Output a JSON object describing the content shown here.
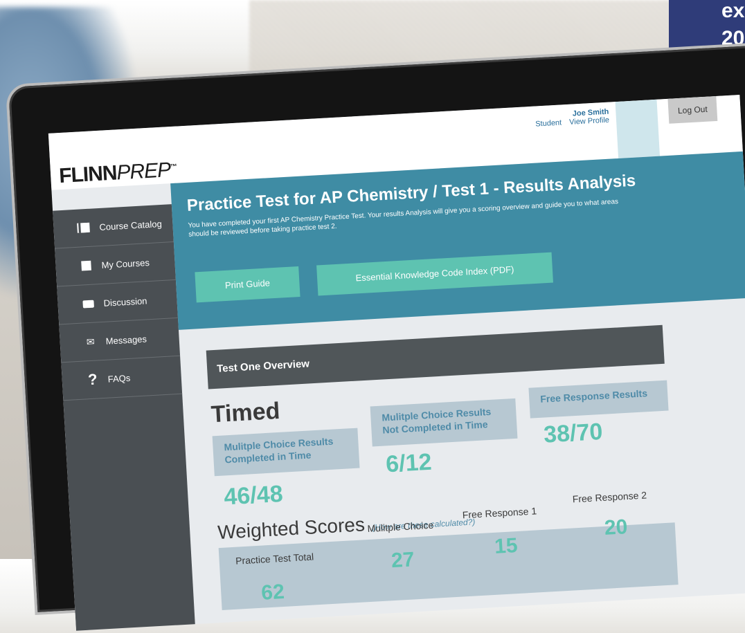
{
  "promo": {
    "line1": "ex",
    "line2": "20"
  },
  "topbar": {
    "user_name": "Joe Smith",
    "user_role": "Student",
    "view_profile": "View Profile",
    "logout": "Log Out"
  },
  "logo": {
    "flinn": "FLINN",
    "prep": "PREP",
    "tm": "™"
  },
  "sidebar": {
    "items": [
      {
        "label": "Course Catalog",
        "icon": "book-icon"
      },
      {
        "label": "My Courses",
        "icon": "course-square-icon"
      },
      {
        "label": "Discussion",
        "icon": "chat-icon"
      },
      {
        "label": "Messages",
        "icon": "envelope-icon"
      },
      {
        "label": "FAQs",
        "icon": "question-icon"
      }
    ]
  },
  "hero": {
    "title": "Practice Test for AP Chemistry / Test 1 - Results Analysis",
    "description": "You have completed your first AP Chemistry Practice Test.  Your results Analysis will give you a scoring overview and guide you to what areas should be reviewed before taking practice test 2.",
    "print_button": "Print Guide",
    "ekc_button": "Essential Knowledge Code Index (PDF)"
  },
  "overview": {
    "title": "Test One Overview"
  },
  "timed": {
    "heading": "Timed",
    "cards": [
      {
        "label": "Mulitple Choice Results Completed in Time",
        "score": "46/48"
      },
      {
        "label": "Mulitple Choice Results Not Completed in Time",
        "score": "6/12"
      },
      {
        "label": "Free Response Results",
        "score": "38/70"
      }
    ]
  },
  "weighted": {
    "heading": "Weighted Scores",
    "note": "(How are these calculated?)",
    "items": [
      {
        "label": "Practice Test Total",
        "value": "62"
      },
      {
        "label": "Mulitple Choice",
        "value": "27"
      },
      {
        "label": "Free Response 1",
        "value": "15"
      },
      {
        "label": "Free Response 2",
        "value": "20"
      }
    ]
  },
  "colors": {
    "accent_teal": "#5ec3b1",
    "hero_blue": "#3f8ca4",
    "sidebar": "#4a4f53",
    "promo_navy": "#2f3c79"
  }
}
